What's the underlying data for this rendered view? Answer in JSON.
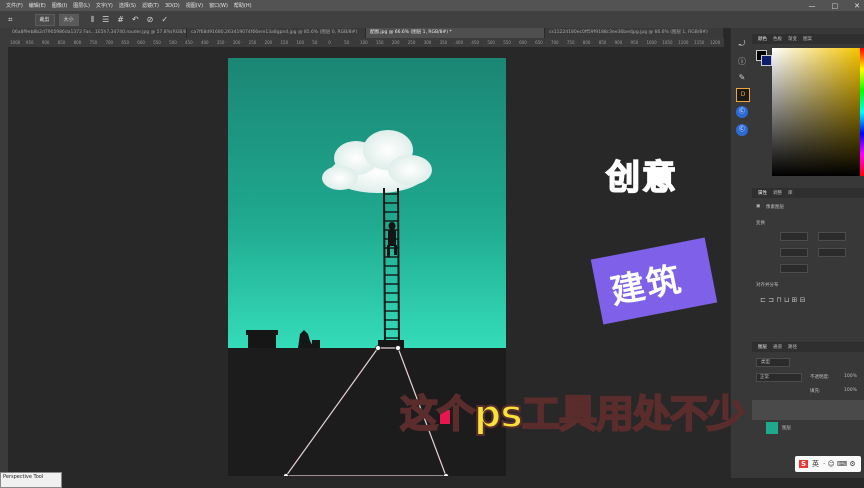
{
  "menubar": {
    "items": [
      "文件(F)",
      "编辑(E)",
      "图像(I)",
      "图层(L)",
      "文字(Y)",
      "选择(S)",
      "滤镜(T)",
      "3D(D)",
      "视图(V)",
      "窗口(W)",
      "帮助(H)"
    ],
    "minimize": "—",
    "maximize": "□",
    "close": "✕"
  },
  "options_bar": {
    "btn1": "裁剪",
    "btn2": "大小"
  },
  "tabs": [
    {
      "label": "06a8f9eb8b2d7905986da1372 Fas...1E5h7,34740.rouder.jpg @ 57.8%(RGB/8#)",
      "active": false
    },
    {
      "label": "ca7f68d91680,263419074f66ere13a8gpnd.jpg @ 85.6% (图层 0, RGB/8#)",
      "active": false
    },
    {
      "label": "配图.jpg @ 66.6% (图层 1, RGB/8#) *",
      "active": true
    },
    {
      "label": "cs1122d180ec0ff59f9188c3ee36bedjpg.jpg @ 66.6% (图层 1, RGB/8#)",
      "active": false
    }
  ],
  "ruler_ticks": [
    "1000",
    "950",
    "900",
    "850",
    "800",
    "750",
    "700",
    "650",
    "600",
    "550",
    "500",
    "450",
    "400",
    "350",
    "300",
    "250",
    "200",
    "150",
    "100",
    "50",
    "0",
    "50",
    "100",
    "150",
    "200",
    "250",
    "300",
    "350",
    "400",
    "450",
    "500",
    "550",
    "600",
    "650",
    "700",
    "750",
    "800",
    "850",
    "900",
    "950",
    "1000",
    "1050",
    "1100",
    "1150",
    "1200"
  ],
  "panels": {
    "color_tabs": [
      "颜色",
      "色板",
      "渐变",
      "图案"
    ],
    "properties_tabs": [
      "属性",
      "调整",
      "库"
    ],
    "pixel_layer": "像素图层",
    "transform": "变换",
    "align_distribute": "对齐并分布",
    "layers_tabs": [
      "图层",
      "通道",
      "路径"
    ],
    "kind_label": "类型",
    "blend_mode": "正常",
    "opacity_label": "不透明度:",
    "opacity_value": "100%",
    "fill_label": "填充:",
    "fill_value": "100%",
    "layer_name_1": "图层"
  },
  "overlays": {
    "text_creative": "创意",
    "text_architecture": "建筑",
    "caption": "这个ps工具用处不少"
  },
  "status_tooltip": "Perspective Tool",
  "ime": {
    "logo": "S",
    "lang": "英",
    "icons": "· ☺ ⌨ ⚙"
  },
  "colors": {
    "teal_top": "#1d8f7d",
    "teal_bottom": "#2fd6b4",
    "ground": "#1c1c1c",
    "purple": "#7e61e8",
    "caption_yellow": "#f7e23a",
    "ps_bg": "#282828"
  }
}
